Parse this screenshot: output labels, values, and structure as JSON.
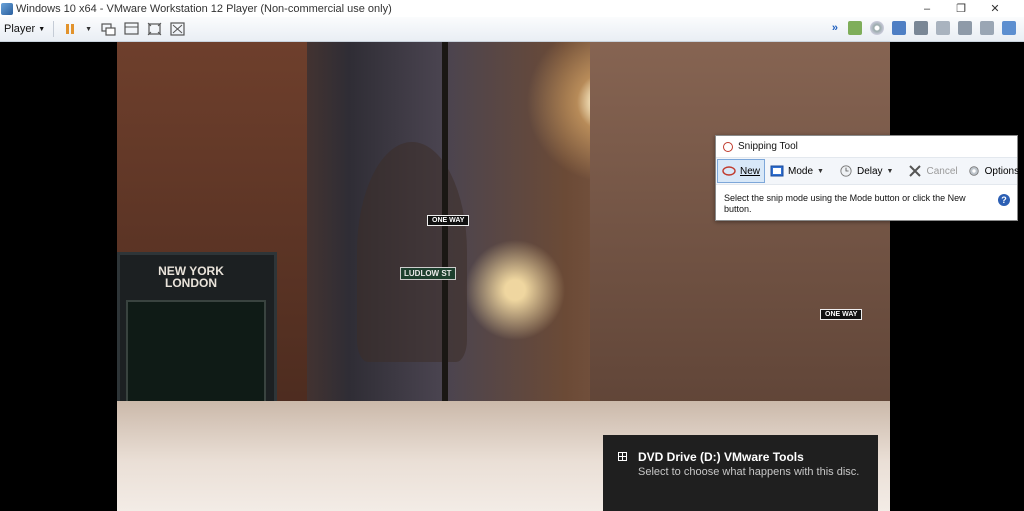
{
  "window": {
    "title": "Windows 10 x64 - VMware Workstation 12 Player (Non-commercial use only)",
    "controls": {
      "minimize": "–",
      "maximize": "❐",
      "close": "✕"
    }
  },
  "toolbar": {
    "player_label": "Player",
    "icons": [
      "pause-icon",
      "send-ctrl-alt-del-icon",
      "unity-icon",
      "fullscreen-icon",
      "view-icon"
    ],
    "right_icons": [
      "more-icon",
      "network-icon",
      "cd-icon",
      "usb-icon",
      "printer-icon",
      "sound-icon",
      "storage-icon",
      "message-icon"
    ],
    "more": "»"
  },
  "wallpaper": {
    "store_sign_line1": "NEW YORK",
    "store_sign_line2": "LONDON",
    "street_sign_1": "LUDLOW ST",
    "street_sign_2": "ONE WAY",
    "street_sign_3": "ONE WAY"
  },
  "snipping_tool": {
    "title": "Snipping Tool",
    "new_label": "New",
    "mode_label": "Mode",
    "delay_label": "Delay",
    "cancel_label": "Cancel",
    "options_label": "Options",
    "message": "Select the snip mode using the Mode button or click the New button.",
    "help": "?"
  },
  "notification": {
    "title": "DVD Drive (D:) VMware Tools",
    "body": "Select to choose what happens with this disc."
  },
  "colors": {
    "accent": "#2c5fb4",
    "toast_bg": "#1f1f1f",
    "pause_orange": "#e2932c"
  }
}
